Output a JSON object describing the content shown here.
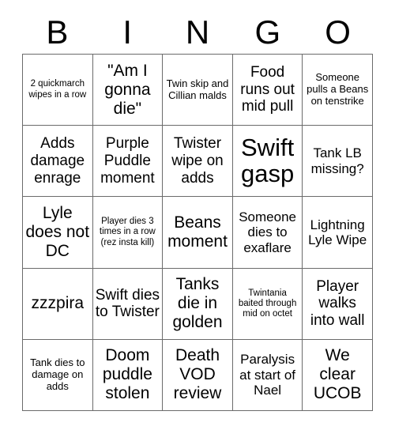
{
  "card": {
    "header_letters": [
      "B",
      "I",
      "N",
      "G",
      "O"
    ],
    "rows": [
      [
        {
          "text": "2 quickmarch wipes in a row",
          "size": "xs"
        },
        {
          "text": "\"Am I gonna die\"",
          "size": "xl"
        },
        {
          "text": "Twin skip and Cillian malds",
          "size": "sm"
        },
        {
          "text": "Food runs out mid pull",
          "size": "lg"
        },
        {
          "text": "Someone pulls a Beans on tenstrike",
          "size": "sm"
        }
      ],
      [
        {
          "text": "Adds damage enrage",
          "size": "lg"
        },
        {
          "text": "Purple Puddle moment",
          "size": "lg"
        },
        {
          "text": "Twister wipe on adds",
          "size": "lg"
        },
        {
          "text": "Swift gasp",
          "size": "xxl"
        },
        {
          "text": "Tank LB missing?",
          "size": "md"
        }
      ],
      [
        {
          "text": "Lyle does not DC",
          "size": "xl"
        },
        {
          "text": "Player dies 3 times in a row (rez insta kill)",
          "size": "xs"
        },
        {
          "text": "Beans moment",
          "size": "xl"
        },
        {
          "text": "Someone dies to exaflare",
          "size": "md"
        },
        {
          "text": "Lightning Lyle Wipe",
          "size": "md"
        }
      ],
      [
        {
          "text": "zzzpira",
          "size": "xl"
        },
        {
          "text": "Swift dies to Twister",
          "size": "lg"
        },
        {
          "text": "Tanks die in golden",
          "size": "xl"
        },
        {
          "text": "Twintania baited through mid on octet",
          "size": "xs"
        },
        {
          "text": "Player walks into wall",
          "size": "lg"
        }
      ],
      [
        {
          "text": "Tank dies to damage on adds",
          "size": "sm"
        },
        {
          "text": "Doom puddle stolen",
          "size": "xl"
        },
        {
          "text": "Death VOD review",
          "size": "xl"
        },
        {
          "text": "Paralysis at start of Nael",
          "size": "md"
        },
        {
          "text": "We clear UCOB",
          "size": "xl"
        }
      ]
    ]
  },
  "colors": {
    "background": "#ffffff",
    "text": "#000000",
    "grid_line": "#6b6b6b"
  }
}
